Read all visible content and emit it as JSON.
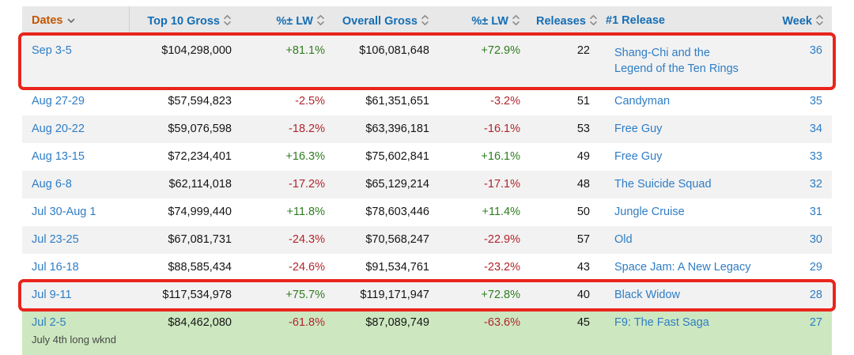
{
  "colors": {
    "header_bg": "#e8e8e8",
    "stripe_bg": "#f2f2f2",
    "holiday_row_bg": "#cde8c0",
    "link_blue": "#2e7dc5",
    "header_link_blue": "#156eb4",
    "sorted_header_orange": "#c45500",
    "positive_green": "#2f7d1f",
    "negative_red": "#b0262d",
    "annotation_red": "#e8251d",
    "body_text": "#141414",
    "note_gray": "#474747",
    "sort_icon_gray": "#8a8a8a"
  },
  "table": {
    "columns": [
      {
        "label": "Dates",
        "align": "left",
        "sort": "desc",
        "active": true
      },
      {
        "label": "Top 10 Gross",
        "align": "right",
        "sort": "both",
        "active": false
      },
      {
        "label": "%± LW",
        "align": "right",
        "sort": "both",
        "active": false
      },
      {
        "label": "Overall Gross",
        "align": "right",
        "sort": "both",
        "active": false
      },
      {
        "label": "%± LW",
        "align": "right",
        "sort": "both",
        "active": false
      },
      {
        "label": "Releases",
        "align": "right",
        "sort": "both",
        "active": false
      },
      {
        "label": "#1 Release",
        "align": "left",
        "sort": "none",
        "active": false
      },
      {
        "label": "Week",
        "align": "right",
        "sort": "both",
        "active": false
      }
    ],
    "rows": [
      {
        "dates": "Sep 3-5",
        "top10_gross": "$104,298,000",
        "pct_lw_top10": "+81.1%",
        "overall_gross": "$106,081,648",
        "pct_lw_overall": "+72.9%",
        "releases": "22",
        "number_one_release": "Shang-Chi and the Legend of the Ten Rings",
        "week": "36",
        "highlight": true,
        "tall": true,
        "holiday": false,
        "note": ""
      },
      {
        "dates": "Aug 27-29",
        "top10_gross": "$57,594,823",
        "pct_lw_top10": "-2.5%",
        "overall_gross": "$61,351,651",
        "pct_lw_overall": "-3.2%",
        "releases": "51",
        "number_one_release": "Candyman",
        "week": "35",
        "highlight": false,
        "tall": false,
        "holiday": false,
        "note": ""
      },
      {
        "dates": "Aug 20-22",
        "top10_gross": "$59,076,598",
        "pct_lw_top10": "-18.2%",
        "overall_gross": "$63,396,181",
        "pct_lw_overall": "-16.1%",
        "releases": "53",
        "number_one_release": "Free Guy",
        "week": "34",
        "highlight": false,
        "tall": false,
        "holiday": false,
        "note": ""
      },
      {
        "dates": "Aug 13-15",
        "top10_gross": "$72,234,401",
        "pct_lw_top10": "+16.3%",
        "overall_gross": "$75,602,841",
        "pct_lw_overall": "+16.1%",
        "releases": "49",
        "number_one_release": "Free Guy",
        "week": "33",
        "highlight": false,
        "tall": false,
        "holiday": false,
        "note": ""
      },
      {
        "dates": "Aug 6-8",
        "top10_gross": "$62,114,018",
        "pct_lw_top10": "-17.2%",
        "overall_gross": "$65,129,214",
        "pct_lw_overall": "-17.1%",
        "releases": "48",
        "number_one_release": "The Suicide Squad",
        "week": "32",
        "highlight": false,
        "tall": false,
        "holiday": false,
        "note": ""
      },
      {
        "dates": "Jul 30-Aug 1",
        "top10_gross": "$74,999,440",
        "pct_lw_top10": "+11.8%",
        "overall_gross": "$78,603,446",
        "pct_lw_overall": "+11.4%",
        "releases": "50",
        "number_one_release": "Jungle Cruise",
        "week": "31",
        "highlight": false,
        "tall": false,
        "holiday": false,
        "note": ""
      },
      {
        "dates": "Jul 23-25",
        "top10_gross": "$67,081,731",
        "pct_lw_top10": "-24.3%",
        "overall_gross": "$70,568,247",
        "pct_lw_overall": "-22.9%",
        "releases": "57",
        "number_one_release": "Old",
        "week": "30",
        "highlight": false,
        "tall": false,
        "holiday": false,
        "note": ""
      },
      {
        "dates": "Jul 16-18",
        "top10_gross": "$88,585,434",
        "pct_lw_top10": "-24.6%",
        "overall_gross": "$91,534,761",
        "pct_lw_overall": "-23.2%",
        "releases": "43",
        "number_one_release": "Space Jam: A New Legacy",
        "week": "29",
        "highlight": false,
        "tall": false,
        "holiday": false,
        "note": ""
      },
      {
        "dates": "Jul 9-11",
        "top10_gross": "$117,534,978",
        "pct_lw_top10": "+75.7%",
        "overall_gross": "$119,171,947",
        "pct_lw_overall": "+72.8%",
        "releases": "40",
        "number_one_release": "Black Widow",
        "week": "28",
        "highlight": true,
        "tall": false,
        "holiday": false,
        "note": ""
      },
      {
        "dates": "Jul 2-5",
        "top10_gross": "$84,462,080",
        "pct_lw_top10": "-61.8%",
        "overall_gross": "$87,089,749",
        "pct_lw_overall": "-63.6%",
        "releases": "45",
        "number_one_release": "F9: The Fast Saga",
        "week": "27",
        "highlight": false,
        "tall": false,
        "holiday": true,
        "note": "July 4th long wknd"
      }
    ]
  },
  "annotations": {
    "highlighted_rows": [
      "Sep 3-5",
      "Jul 9-11"
    ]
  }
}
